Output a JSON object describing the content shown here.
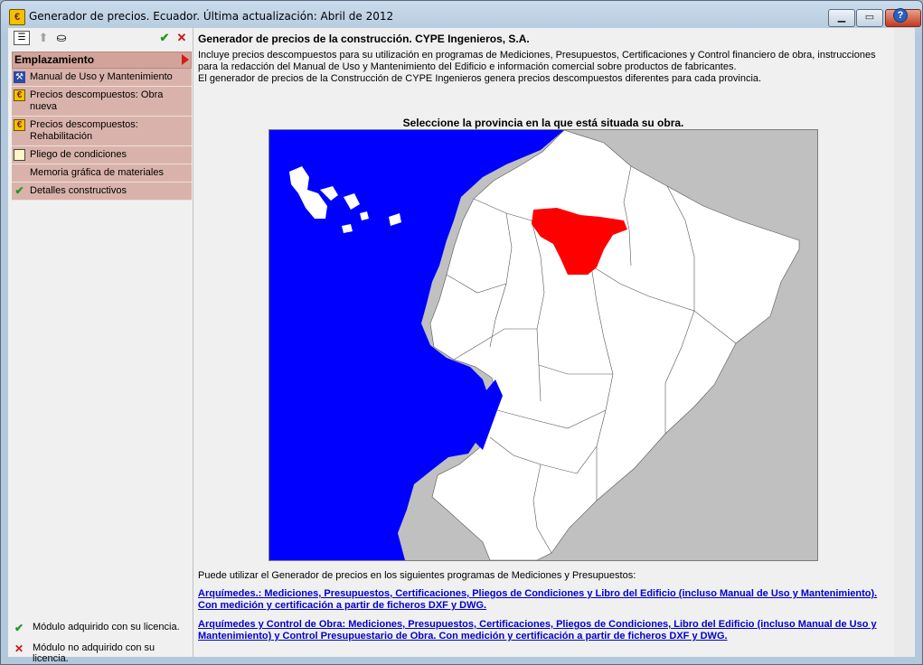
{
  "window": {
    "title": "Generador de precios. Ecuador. Última actualización: Abril de 2012",
    "icon": "euro-icon",
    "buttons": {
      "minimize": "▁",
      "maximize": "▭",
      "close": "✕"
    }
  },
  "toolbar": {
    "list_icon": "list-icon",
    "up_icon": "up-arrow-icon",
    "find_icon": "binoculars-icon",
    "accept_icon": "check-icon",
    "cancel_icon": "cross-icon"
  },
  "menu": {
    "header": "Emplazamiento",
    "items": [
      {
        "label": "Manual de Uso y Mantenimiento",
        "icon": "tool-icon"
      },
      {
        "label": "Precios descompuestos: Obra nueva",
        "icon": "euro-icon"
      },
      {
        "label": "Precios descompuestos: Rehabilitación",
        "icon": "euro-icon"
      },
      {
        "label": "Pliego de condiciones",
        "icon": "document-icon"
      },
      {
        "label": "Memoria gráfica de materiales",
        "icon": ""
      },
      {
        "label": "Detalles constructivos",
        "icon": "check-icon"
      }
    ]
  },
  "legend": {
    "acquired": "Módulo adquirido con su licencia.",
    "not_acquired": "Módulo no adquirido con su licencia."
  },
  "main": {
    "heading": "Generador de precios de la construcción. CYPE Ingenieros, S.A.",
    "description_1": "Incluye precios descompuestos para su utilización en programas de Mediciones, Presupuestos, Certificaciones y Control financiero de obra, instrucciones para la redacción del Manual de Uso y Mantenimiento del Edificio e información comercial sobre productos de fabricantes.",
    "description_2": "El generador de precios de la Construcción de CYPE Ingenieros genera precios descompuestos diferentes para cada provincia.",
    "map_caption": "Seleccione la provincia en la que está situada su obra.",
    "uses_text": "Puede utilizar el Generador de precios en los siguientes programas de Mediciones y Presupuestos:",
    "link_1": "Arquímedes.: Mediciones, Presupuestos, Certificaciones, Pliegos de Condiciones y Libro del Edificio (incluso Manual de Uso y Mantenimiento). Con medición y certificación a partir de ficheros DXF y DWG.",
    "link_2": "Arquímedes y Control de Obra: Mediciones, Presupuestos, Certificaciones, Pliegos de Condiciones, Libro del Edificio (incluso Manual de Uso y Mantenimiento) y Control Presupuestario de Obra. Con medición y certificación a partir de ficheros DXF y DWG.",
    "help_icon": "help-icon"
  },
  "colors": {
    "sea": "#0000ff",
    "land": "#ffffff",
    "selected_province": "#ff0000",
    "background": "#c0c0c0"
  }
}
